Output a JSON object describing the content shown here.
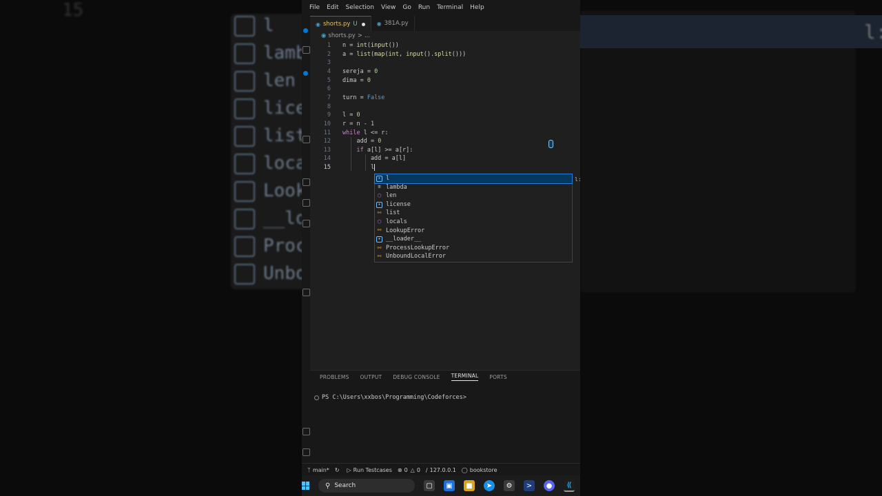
{
  "menu": [
    "File",
    "Edit",
    "Selection",
    "View",
    "Go",
    "Run",
    "Terminal",
    "Help"
  ],
  "tabs": [
    {
      "label": "shorts.py",
      "badge": "U",
      "modified": true,
      "active": true
    },
    {
      "label": "381A.py",
      "badge": "",
      "modified": false,
      "active": false
    }
  ],
  "breadcrumb": {
    "file": "shorts.py",
    "sep": ">",
    "rest": "..."
  },
  "code": {
    "lines": [
      {
        "num": "1",
        "html": "n = <span class=\"fn\">int</span>(<span class=\"fn\">input</span>())"
      },
      {
        "num": "2",
        "html": "a = <span class=\"fn\">list</span>(<span class=\"fn\">map</span>(<span class=\"fn\">int</span>, <span class=\"fn\">input</span>().<span class=\"fn\">split</span>()))"
      },
      {
        "num": "3",
        "html": ""
      },
      {
        "num": "4",
        "html": "sereja = <span class=\"num\">0</span>"
      },
      {
        "num": "5",
        "html": "dima = <span class=\"num\">0</span>"
      },
      {
        "num": "6",
        "html": ""
      },
      {
        "num": "7",
        "html": "turn = <span class=\"const\">False</span>"
      },
      {
        "num": "8",
        "html": ""
      },
      {
        "num": "9",
        "html": "l = <span class=\"num\">0</span>"
      },
      {
        "num": "10",
        "html": "r = n - <span class=\"num\">1</span>"
      },
      {
        "num": "11",
        "html": "<span class=\"kw\">while</span> l &lt;= r:"
      },
      {
        "num": "12",
        "html": "    add = <span class=\"num\">0</span>"
      },
      {
        "num": "13",
        "html": "    <span class=\"kw\">if</span> a[l] &gt;= a[r]:"
      },
      {
        "num": "14",
        "html": "        add = a[l]"
      },
      {
        "num": "15",
        "html": "        l<span class=\"cursor\"></span>"
      }
    ],
    "current_line": "15"
  },
  "suggestions": [
    {
      "label": "l",
      "kind": "var",
      "selected": true
    },
    {
      "label": "lambda",
      "kind": "kw",
      "selected": false
    },
    {
      "label": "len",
      "kind": "fn",
      "selected": false
    },
    {
      "label": "license",
      "kind": "var",
      "selected": false
    },
    {
      "label": "list",
      "kind": "cls",
      "selected": false
    },
    {
      "label": "locals",
      "kind": "fn",
      "selected": false
    },
    {
      "label": "LookupError",
      "kind": "cls",
      "selected": false
    },
    {
      "label": "__loader__",
      "kind": "var",
      "selected": false
    },
    {
      "label": "ProcessLookupError",
      "kind": "cls",
      "selected": false
    },
    {
      "label": "UnboundLocalError",
      "kind": "cls",
      "selected": false
    }
  ],
  "suggest_detail": "l:",
  "panel": {
    "tabs": [
      "PROBLEMS",
      "OUTPUT",
      "DEBUG CONSOLE",
      "TERMINAL",
      "PORTS"
    ],
    "active": "TERMINAL",
    "prompt": "PS C:\\Users\\xxbos\\Programming\\Codeforces>"
  },
  "status": {
    "branch": "main*",
    "run": "Run Testcases",
    "errors": "0",
    "warnings": "0",
    "host": "127.0.0.1",
    "db": "bookstore"
  },
  "taskbar": {
    "search": "Search"
  },
  "background": {
    "items": [
      "l",
      "lamb",
      "len",
      "lice",
      "list",
      "loca",
      "Look",
      "__lo",
      "Proc",
      "Unbo"
    ],
    "top": "15",
    "right": "l:"
  }
}
